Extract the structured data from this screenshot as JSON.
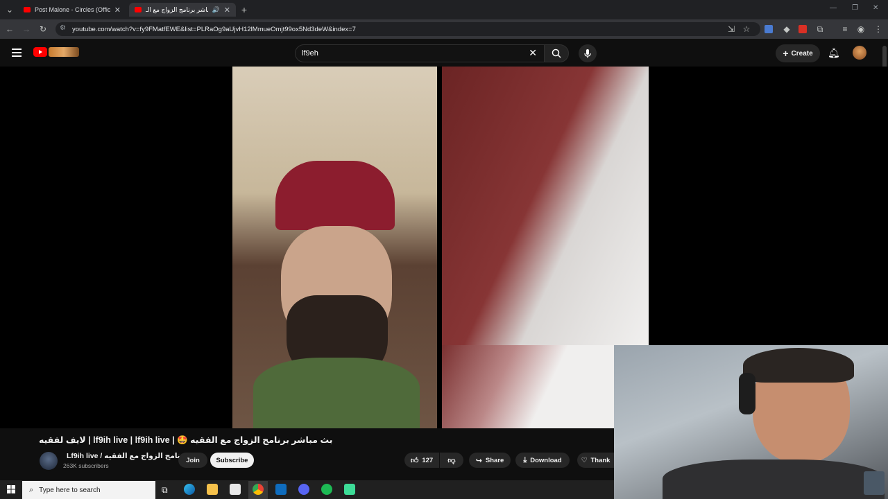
{
  "browser": {
    "tabs": [
      {
        "title": "Post Malone - Circles (Official M",
        "active": false
      },
      {
        "title": "بث مباشر برنامج الزواج مع الـ",
        "active": true
      }
    ],
    "url": "youtube.com/watch?v=fy9FMatfEWE&list=PLRaOg9aUjvH12lMmueOmjt99ox5Nd3deW&index=7"
  },
  "youtube": {
    "search_value": "lf9eh",
    "create_label": "Create",
    "video_title": "لايف لفقيه | lf9ih live | lf9ih live | 🤩 بث مباشر برنامج الزواج مع الفقيه",
    "channel_name": "Lf9ih live / برنامج الزواج مع الفقيه",
    "subscribers": "263K subscribers",
    "join_label": "Join",
    "subscribe_label": "Subscribe",
    "like_count": "127",
    "share_label": "Share",
    "download_label": "Download",
    "thanks_label": "Thank"
  },
  "taskbar": {
    "search_placeholder": "Type here to search"
  },
  "colors": {
    "yt_red": "#ff0000",
    "bg": "#0f0f0f",
    "chrome_bg": "#202124"
  }
}
